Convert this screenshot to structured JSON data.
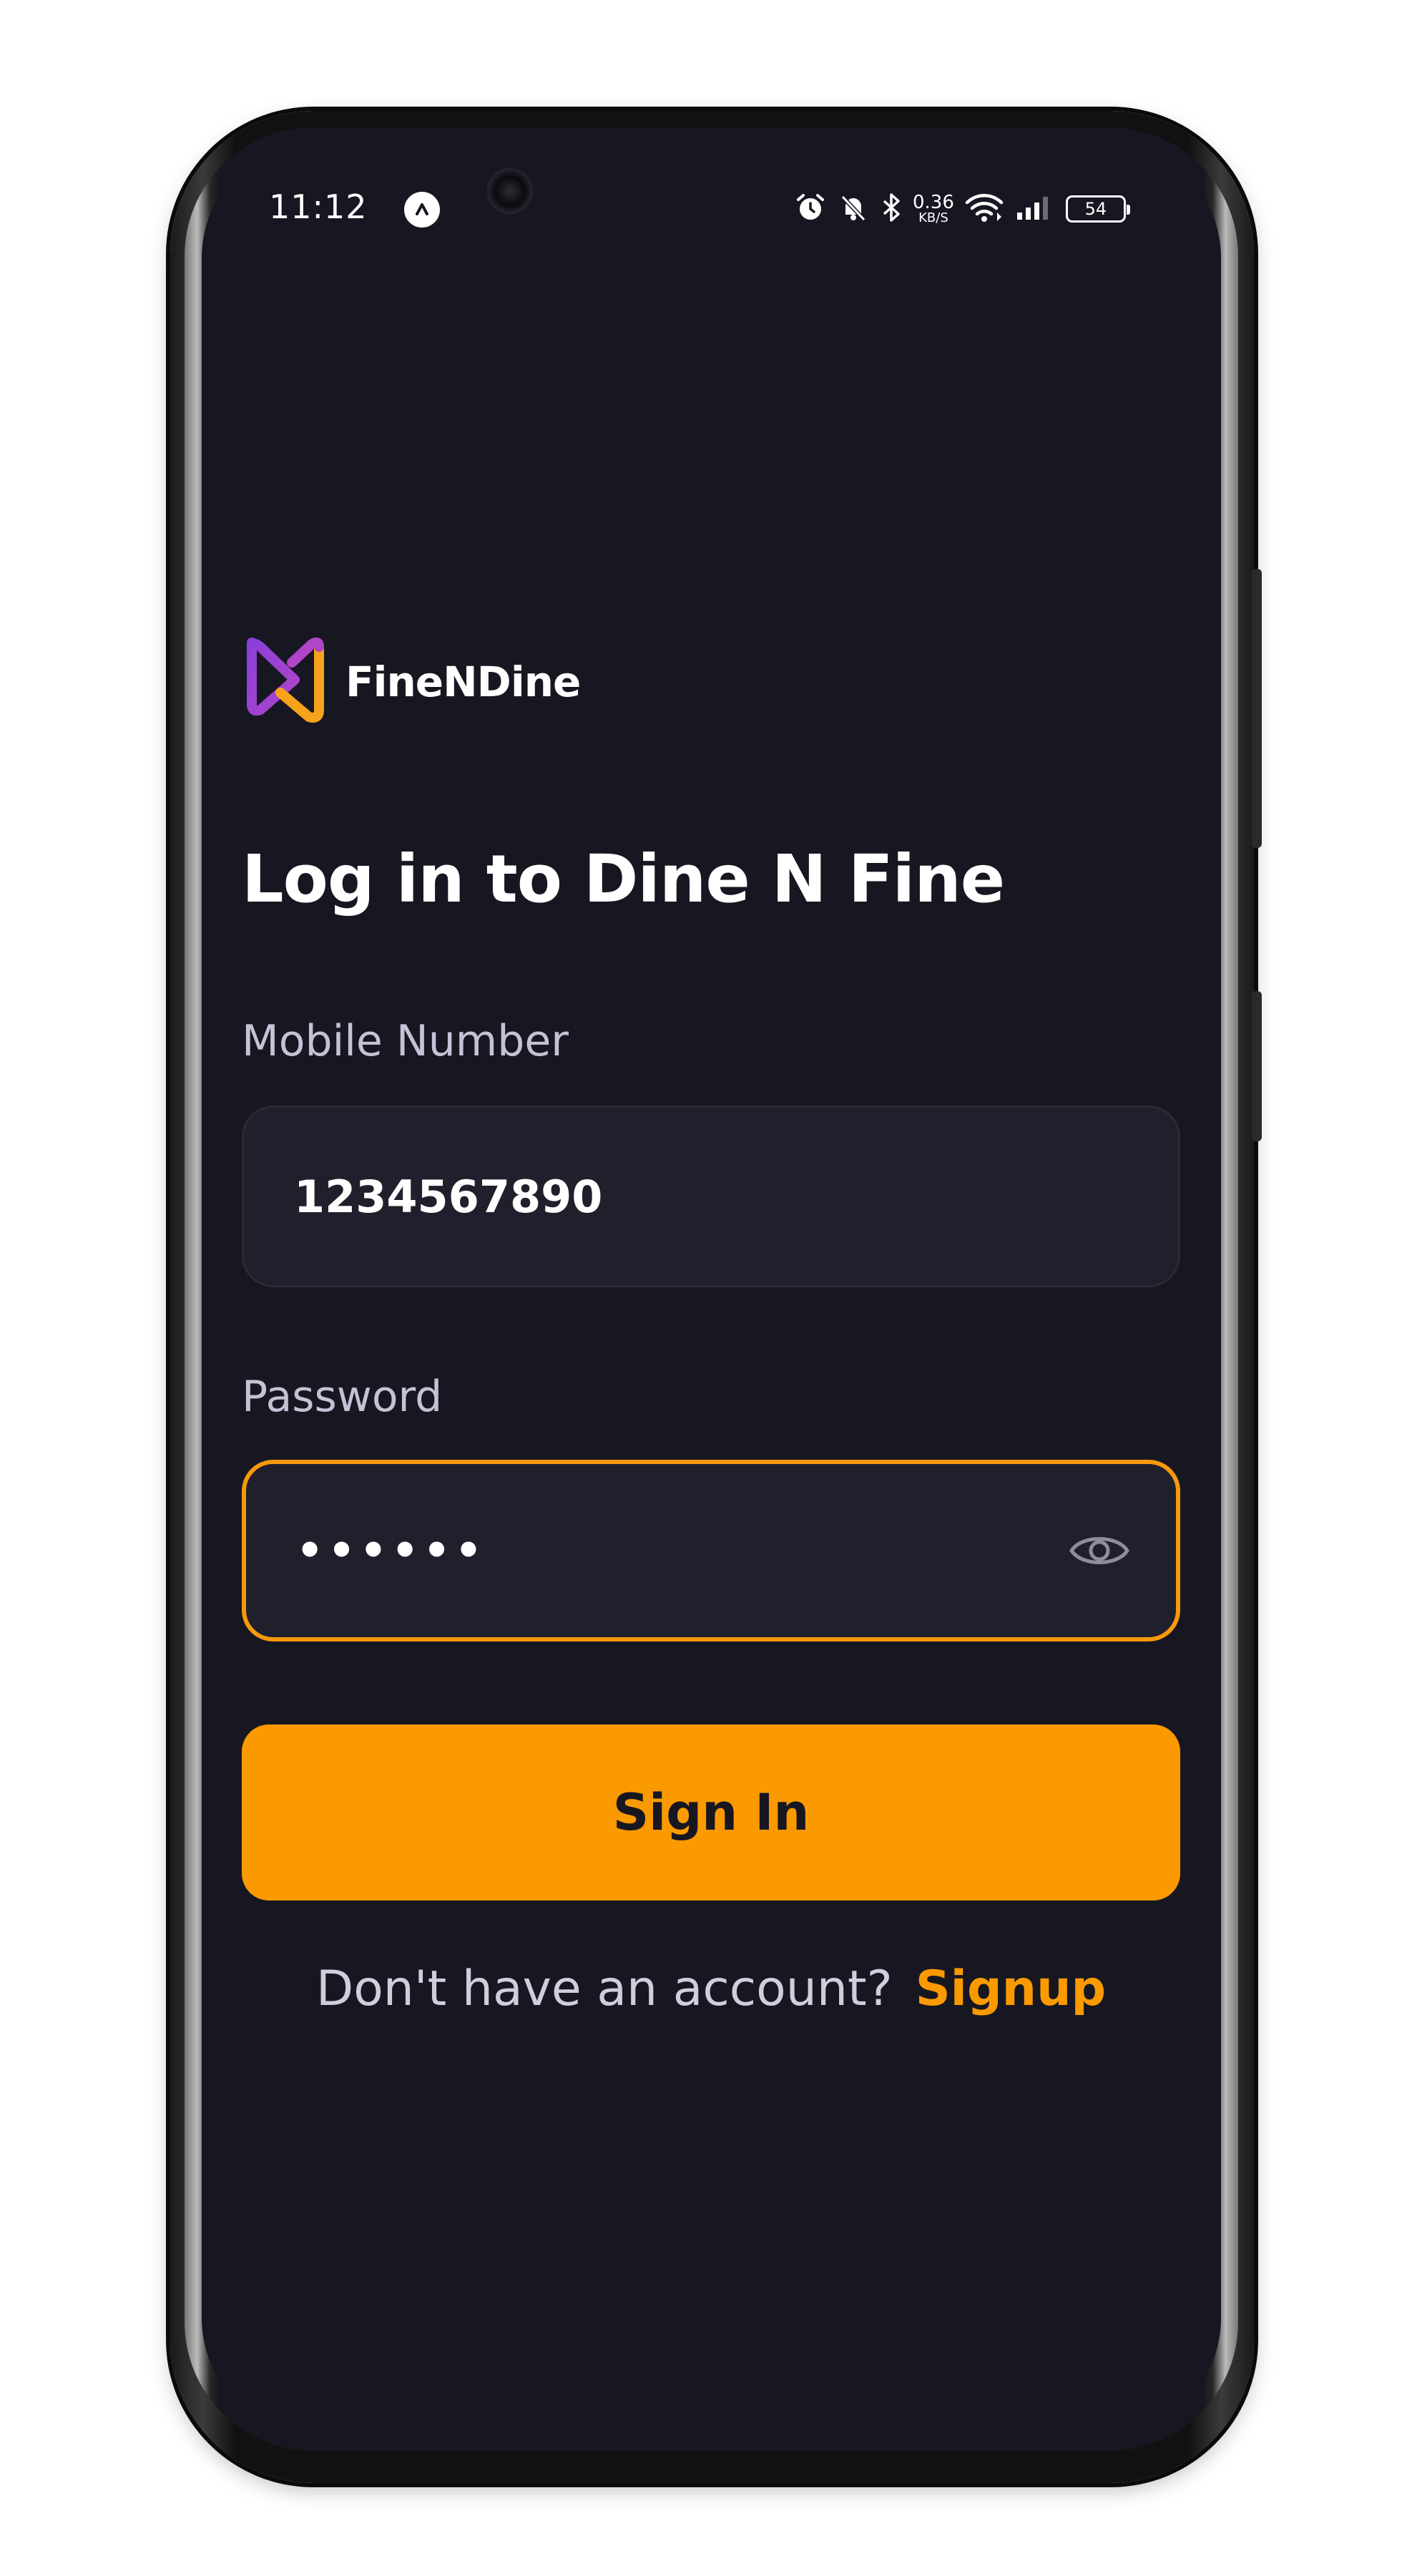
{
  "status_bar": {
    "time": "11:12",
    "network_speed_value": "0.36",
    "network_speed_unit": "KB/S",
    "battery": "54",
    "icons": [
      "app-notification-icon",
      "alarm-icon",
      "bell-muted-icon",
      "bluetooth-icon",
      "wifi-icon",
      "signal-icon",
      "battery-icon"
    ]
  },
  "brand": {
    "name": "FineNDine",
    "logo_colors": [
      "#8b3fd9",
      "#f7a21b"
    ]
  },
  "login": {
    "title": "Log in to Dine N Fine",
    "mobile_label": "Mobile Number",
    "mobile_value": "1234567890",
    "password_label": "Password",
    "password_value": "••••••",
    "sign_in_label": "Sign In",
    "signup_prompt": "Don't have an account?",
    "signup_link": "Signup"
  },
  "colors": {
    "background": "#171722",
    "accent": "#fa9a00",
    "field_background": "#20202c",
    "label_text": "#c4c3d6"
  }
}
